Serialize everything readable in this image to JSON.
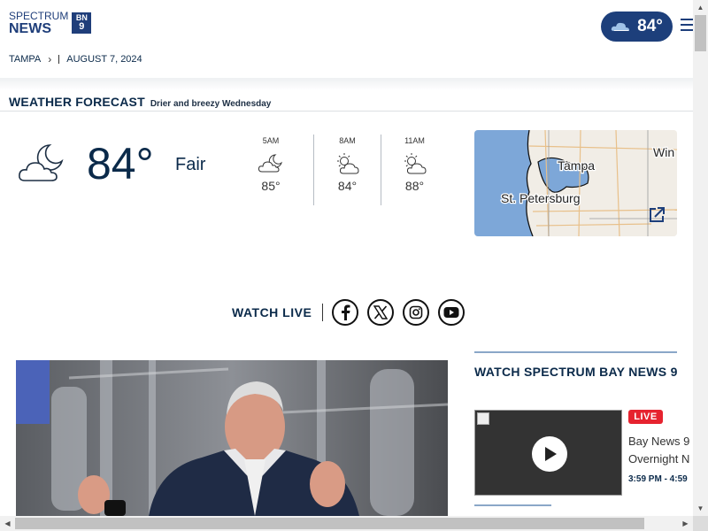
{
  "header": {
    "logo": {
      "line1": "SPECTRUM",
      "line2": "NEWS",
      "badge_top": "BN",
      "badge_num": "9"
    },
    "weather_pill": {
      "temp": "84°",
      "icon": "cloud-icon"
    },
    "menu_icon": "hamburger-menu-icon"
  },
  "breadcrumb": {
    "location": "TAMPA",
    "date": "AUGUST 7, 2024"
  },
  "forecast": {
    "title": "WEATHER FORECAST",
    "subtitle": "Drier and breezy Wednesday",
    "current": {
      "temp": "84°",
      "condition": "Fair",
      "icon": "moon-cloud-icon"
    },
    "hourly": [
      {
        "time": "5AM",
        "temp": "85°",
        "icon": "moon-cloud-icon"
      },
      {
        "time": "8AM",
        "temp": "84°",
        "icon": "sun-cloud-icon"
      },
      {
        "time": "11AM",
        "temp": "88°",
        "icon": "sun-cloud-icon"
      }
    ],
    "map": {
      "labels": [
        "Tampa",
        "St. Petersburg",
        "Win"
      ],
      "expand_icon": "external-link-icon"
    }
  },
  "watch_live": {
    "label": "WATCH LIVE",
    "social": [
      {
        "name": "facebook-icon"
      },
      {
        "name": "x-icon"
      },
      {
        "name": "instagram-icon"
      },
      {
        "name": "youtube-icon"
      }
    ]
  },
  "sidebar": {
    "title": "WATCH SPECTRUM BAY NEWS 9",
    "live_badge": "LIVE",
    "show_title_1": "Bay News 9",
    "show_title_2": "Overnight N",
    "show_time": "3:59 PM - 4:59"
  },
  "colors": {
    "brand": "#1d3f7b",
    "live_red": "#e6232f",
    "text": "#0b2a4a",
    "water": "#7da7d8"
  }
}
